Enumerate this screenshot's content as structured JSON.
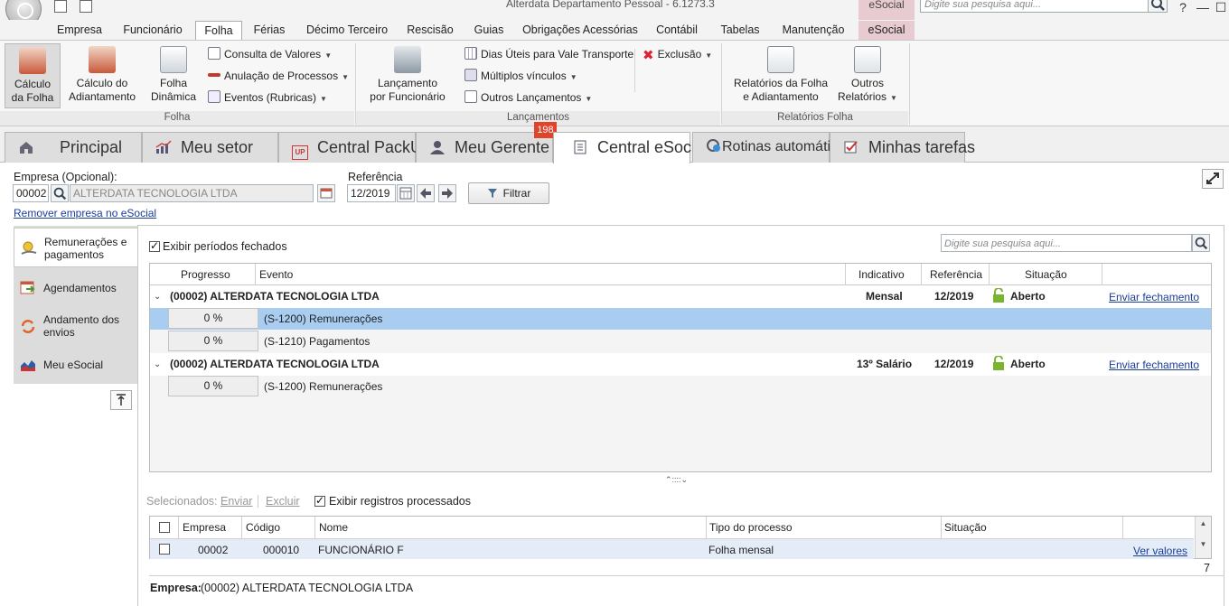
{
  "window": {
    "title": "Alterdata Departamento Pessoal - 6.1273.3",
    "context_tab": "eSocial",
    "search_placeholder": "Digite sua pesquisa aqui...",
    "controls": [
      "?",
      "—",
      "☐"
    ]
  },
  "menu": {
    "tabs": [
      "Empresa",
      "Funcionário",
      "Folha",
      "Férias",
      "Décimo Terceiro",
      "Rescisão",
      "Guias",
      "Obrigações Acessórias",
      "Contábil",
      "Tabelas",
      "Manutenção",
      "eSocial"
    ],
    "active": "Folha"
  },
  "ribbon": {
    "folha": {
      "calculo_folha": [
        "Cálculo",
        "da Folha"
      ],
      "calculo_adiantamento": [
        "Cálculo do",
        "Adiantamento"
      ],
      "folha_dinamica": [
        "Folha",
        "Dinâmica"
      ],
      "consulta_valores": "Consulta de Valores",
      "anulacao_processos": "Anulação de Processos",
      "eventos_rubricas": "Eventos (Rubricas)",
      "group_label": "Folha"
    },
    "lancamentos": {
      "lancamento_funcionario": [
        "Lançamento",
        "por Funcionário"
      ],
      "dias_uteis": "Dias Úteis para Vale Transporte",
      "multiplos_vinculos": "Múltiplos vínculos",
      "outros_lancamentos": "Outros Lançamentos",
      "exclusao": "Exclusão",
      "group_label": "Lançamentos"
    },
    "relatorios": {
      "relatorios_folha": [
        "Relatórios da Folha",
        "e Adiantamento"
      ],
      "outros_relatorios": [
        "Outros",
        "Relatórios"
      ],
      "group_label": "Relatórios Folha"
    }
  },
  "page_tabs": {
    "principal": "Principal",
    "meu_setor": "Meu setor",
    "central_packup": "Central PackUp",
    "meu_gerente": "Meu Gerente",
    "meu_gerente_badge": "198",
    "central_esocial": "Central eSocial",
    "rotinas": "Rotinas automáticas",
    "minhas_tarefas": "Minhas tarefas",
    "packup_icon_text": "UP"
  },
  "filters": {
    "empresa_label": "Empresa (Opcional):",
    "empresa_code": "00002",
    "empresa_name": "ALTERDATA TECNOLOGIA  LTDA",
    "referencia_label": "Referência",
    "referencia_value": "12/2019",
    "filtrar": "Filtrar",
    "remover_link": "Remover empresa no eSocial"
  },
  "side_nav": {
    "remuneracoes": [
      "Remunerações e",
      "pagamentos"
    ],
    "agendamentos": "Agendamentos",
    "andamento": [
      "Andamento dos",
      "envios"
    ],
    "meu_esocial": "Meu eSocial"
  },
  "main": {
    "exibir_fechados": "Exibir períodos fechados",
    "search_placeholder": "Digite sua pesquisa aqui...",
    "columns": {
      "progresso": "Progresso",
      "evento": "Evento",
      "indicativo": "Indicativo",
      "referencia": "Referência",
      "situacao": "Situação"
    },
    "groups": [
      {
        "empresa": "(00002) ALTERDATA TECNOLOGIA  LTDA",
        "indicativo": "Mensal",
        "referencia": "12/2019",
        "situacao": "Aberto",
        "acao": "Enviar fechamento",
        "events": [
          {
            "progress": "0 %",
            "evento": "(S-1200) Remunerações"
          },
          {
            "progress": "0 %",
            "evento": "(S-1210) Pagamentos"
          }
        ]
      },
      {
        "empresa": "(00002) ALTERDATA TECNOLOGIA  LTDA",
        "indicativo": "13º Salário",
        "referencia": "12/2019",
        "situacao": "Aberto",
        "acao": "Enviar fechamento",
        "events": [
          {
            "progress": "0 %",
            "evento": "(S-1200) Remunerações"
          }
        ]
      }
    ]
  },
  "bottom": {
    "selecionados": "Selecionados:",
    "enviar": "Enviar",
    "excluir": "Excluir",
    "exibir_processados": "Exibir registros processados",
    "columns": {
      "empresa": "Empresa",
      "codigo": "Código",
      "nome": "Nome",
      "tipo": "Tipo do processo",
      "situacao": "Situação"
    },
    "row": {
      "empresa": "00002",
      "codigo": "000010",
      "nome": "FUNCIONÁRIO F",
      "tipo": "Folha mensal",
      "situacao": "",
      "acao": "Ver valores"
    },
    "count": "7",
    "footer_label": "Empresa:",
    "footer_value": "(00002) ALTERDATA TECNOLOGIA  LTDA"
  },
  "colors": {
    "selected_row": "#a8cdf0",
    "accent_link": "#1a3d9a",
    "badge": "#e0452b",
    "lock_green": "#7ab32e"
  }
}
